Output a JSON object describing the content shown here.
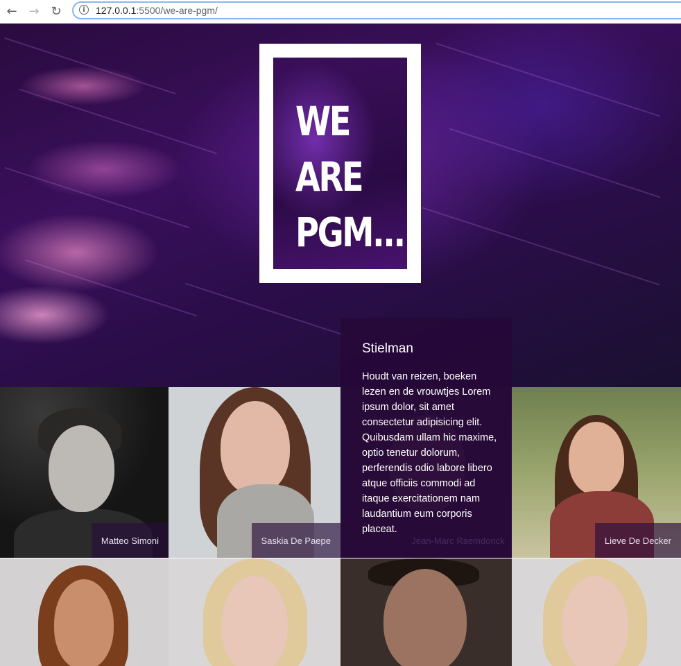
{
  "browser": {
    "url_host": "127.0.0.1",
    "url_rest": ":5500/we-are-pgm/",
    "back_icon": "arrow-left-icon",
    "forward_icon": "arrow-right-icon",
    "reload_icon": "reload-icon",
    "info_icon": "info-icon"
  },
  "hero": {
    "logo_lines": [
      "WE",
      "ARE",
      "PGM..."
    ]
  },
  "members": [
    {
      "name": "Matteo Simoni"
    },
    {
      "name": "Saskia De Paepe"
    },
    {
      "name": "Jean-Marc Raemdonck"
    },
    {
      "name": "Lieve De Decker"
    }
  ],
  "featured": {
    "title": "Stielman",
    "text": "Houdt van reizen, boeken lezen en de vrouwtjes Lorem ipsum dolor, sit amet consectetur adipisicing elit. Quibusdam ullam hic maxime, optio tenetur dolorum, perferendis odio labore libero atque officiis commodi ad itaque exercitationem nam laudantium eum corporis placeat."
  },
  "colors": {
    "accent": "#3a0f5c",
    "overlay": "#26083a",
    "browser_focus": "#8ab4f8"
  }
}
